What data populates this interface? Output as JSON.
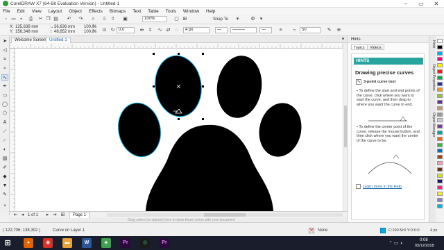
{
  "window": {
    "title": "CorelDRAW X7 (64-Bit Evaluation Version) - Untitled-1",
    "minimize": "–",
    "maximize": "▭",
    "close": "✕"
  },
  "menu": [
    "File",
    "Edit",
    "View",
    "Layout",
    "Object",
    "Effects",
    "Bitmaps",
    "Text",
    "Table",
    "Tools",
    "Window",
    "Help"
  ],
  "standard_toolbar": {
    "zoom_value": "100%",
    "snap_to_label": "Snap To"
  },
  "property_bar": {
    "x_label": "X:",
    "x_value": "125,639 mm",
    "y_label": "Y:",
    "y_value": "156,348 mm",
    "w_value": "36,636 mm",
    "h_value": "48,852 mm",
    "scale_w": "100,0",
    "scale_h": "100,0",
    "percent": "%",
    "angle_value": "0,0",
    "outline_width": "4 px",
    "smoothing_value": "50"
  },
  "document_tabs": [
    "Welcome Screen",
    "Untitled-1"
  ],
  "page_nav": {
    "position": "1 of 1",
    "page_tab": "Page 1",
    "drag_hint": "Drag colors (or objects) here to store these colors with your document"
  },
  "docker": {
    "header": "Hints",
    "tabs": [
      "Topics",
      "Videos"
    ],
    "hints_title": "HINTS",
    "heading": "Drawing precise curves",
    "tool_name": "3-point curve tool",
    "para1": "To define the start and end points of the curve, click where you want to start the curve, and then drag to where you want the curve to end.",
    "para2": "To define the center point of the curve, release the mouse button, and then click where you want the center of the curve to be.",
    "learn_more": "Learn more in the Help"
  },
  "vertical_tabs": [
    "Hints",
    "Object Properties",
    "Object Manager"
  ],
  "status": {
    "coords": "( 122,706; 138,302 )",
    "selection": "Curve on Layer 1",
    "fill_label": "None",
    "outline_info": "C:100 M:0 Y:0 K:0",
    "outline_width": "4 px"
  },
  "taskbar": {
    "time": "0:08",
    "date": "03/12/2018"
  },
  "colors": {
    "accent_teal": "#27a49d",
    "outline_cyan": "#00aeef",
    "fill_black": "#000000"
  }
}
